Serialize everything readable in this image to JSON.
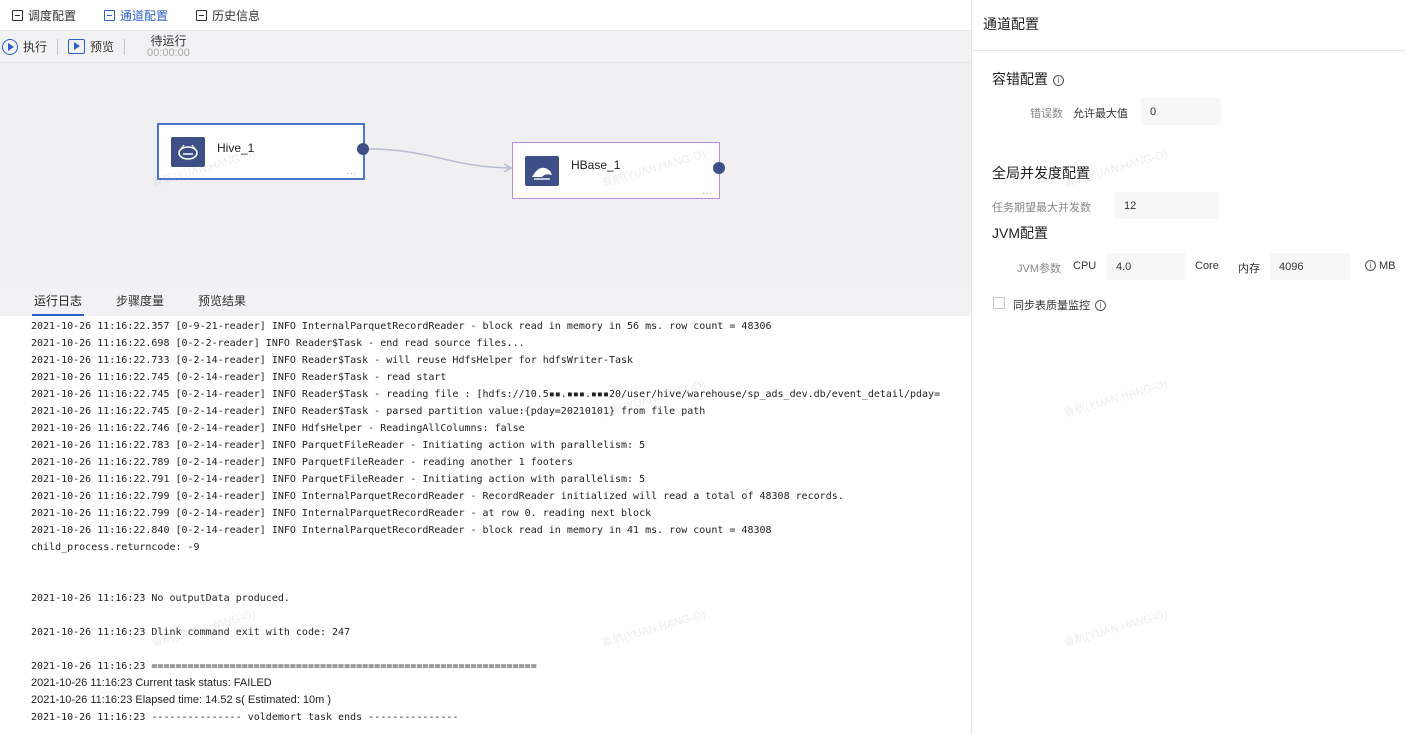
{
  "top_tabs": [
    {
      "label": "调度配置",
      "active": false
    },
    {
      "label": "通道配置",
      "active": true
    },
    {
      "label": "历史信息",
      "active": false
    }
  ],
  "toolbar": {
    "run_label": "执行",
    "preview_label": "预览",
    "status": "待运行",
    "timer": "00:00:00"
  },
  "nodes": {
    "hive": {
      "label": "Hive_1",
      "more": "...",
      "icon": "hive-bee-icon"
    },
    "hbase": {
      "label": "HBase_1",
      "more": "...",
      "icon": "hbase-whale-icon"
    }
  },
  "log_tabs": [
    {
      "label": "运行日志",
      "active": true
    },
    {
      "label": "步骤度量",
      "active": false
    },
    {
      "label": "预览结果",
      "active": false
    }
  ],
  "log_lines": [
    "2021-10-26 11:16:22.357 [0-9-21-reader] INFO InternalParquetRecordReader - block read in memory in 56 ms. row count = 48306",
    "2021-10-26 11:16:22.698 [0-2-2-reader] INFO Reader$Task - end read source files...",
    "2021-10-26 11:16:22.733 [0-2-14-reader] INFO Reader$Task - will reuse HdfsHelper for hdfsWriter-Task",
    "2021-10-26 11:16:22.745 [0-2-14-reader] INFO Reader$Task - read start",
    "2021-10-26 11:16:22.745 [0-2-14-reader] INFO Reader$Task - reading file : [hdfs://10.5▪▪.▪▪▪.▪▪▪20/user/hive/warehouse/sp_ads_dev.db/event_detail/pday=",
    "2021-10-26 11:16:22.745 [0-2-14-reader] INFO Reader$Task - parsed partition value:{pday=20210101} from file path",
    "2021-10-26 11:16:22.746 [0-2-14-reader] INFO HdfsHelper - ReadingAllColumns: false",
    "2021-10-26 11:16:22.783 [0-2-14-reader] INFO ParquetFileReader - Initiating action with parallelism: 5",
    "2021-10-26 11:16:22.789 [0-2-14-reader] INFO ParquetFileReader - reading another 1 footers",
    "2021-10-26 11:16:22.791 [0-2-14-reader] INFO ParquetFileReader - Initiating action with parallelism: 5",
    "2021-10-26 11:16:22.799 [0-2-14-reader] INFO InternalParquetRecordReader - RecordReader initialized will read a total of 48308 records.",
    "2021-10-26 11:16:22.799 [0-2-14-reader] INFO InternalParquetRecordReader - at row 0. reading next block",
    "2021-10-26 11:16:22.840 [0-2-14-reader] INFO InternalParquetRecordReader - block read in memory in 41 ms. row count = 48308",
    "child_process.returncode: -9",
    "",
    "",
    "2021-10-26 11:16:23 No outputData produced.",
    "",
    "2021-10-26 11:16:23 Dlink command exit with code: 247",
    "",
    "2021-10-26 11:16:23 ================================================================",
    "2021-10-26 11:16:23 Current task status: FAILED",
    "2021-10-26 11:16:23 Elapsed time: 14.52 s( Estimated: 10m )",
    "2021-10-26 11:16:23 --------------- voldemort task ends ---------------"
  ],
  "panel": {
    "title": "通道配置",
    "fault": {
      "title": "容错配置",
      "label": "错误数",
      "sub_label": "允许最大值",
      "value": "0"
    },
    "concurrency": {
      "title": "全局并发度配置",
      "label": "任务期望最大并发数",
      "value": "12"
    },
    "jvm": {
      "title": "JVM配置",
      "label": "JVM参数",
      "cpu_label": "CPU",
      "cpu_value": "4.0",
      "core_label": "Core",
      "mem_label": "内存",
      "mem_value": "4096",
      "mb_label": "MB"
    },
    "sync_quality": {
      "label": "同步表质量监控",
      "checked": false
    }
  },
  "watermark": "袁航(YUAN.HANG-O)",
  "colors": {
    "accent": "#2b5fce",
    "node_icon_bg": "#3d4f86",
    "hive_border": "#4a77c9",
    "hbase_border": "#b88cd2"
  }
}
